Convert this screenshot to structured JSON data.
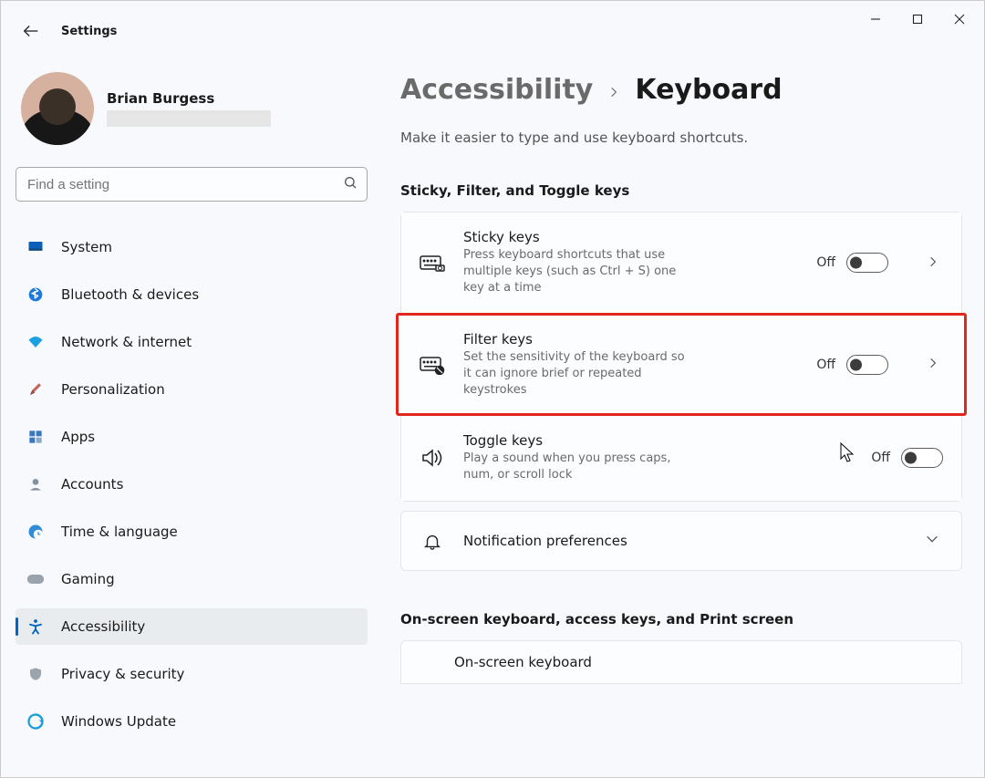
{
  "app_title": "Settings",
  "user": {
    "name": "Brian Burgess"
  },
  "search": {
    "placeholder": "Find a setting"
  },
  "nav": {
    "items": [
      {
        "label": "System"
      },
      {
        "label": "Bluetooth & devices"
      },
      {
        "label": "Network & internet"
      },
      {
        "label": "Personalization"
      },
      {
        "label": "Apps"
      },
      {
        "label": "Accounts"
      },
      {
        "label": "Time & language"
      },
      {
        "label": "Gaming"
      },
      {
        "label": "Accessibility"
      },
      {
        "label": "Privacy & security"
      },
      {
        "label": "Windows Update"
      }
    ]
  },
  "breadcrumb": {
    "parent": "Accessibility",
    "current": "Keyboard"
  },
  "subtitle": "Make it easier to type and use keyboard shortcuts.",
  "sections": {
    "keys_title": "Sticky, Filter, and Toggle keys",
    "osk_title": "On-screen keyboard, access keys, and Print screen"
  },
  "cards": {
    "sticky": {
      "title": "Sticky keys",
      "desc": "Press keyboard shortcuts that use multiple keys (such as Ctrl + S) one key at a time",
      "state": "Off"
    },
    "filter": {
      "title": "Filter keys",
      "desc": "Set the sensitivity of the keyboard so it can ignore brief or repeated keystrokes",
      "state": "Off"
    },
    "toggle": {
      "title": "Toggle keys",
      "desc": "Play a sound when you press caps, num, or scroll lock",
      "state": "Off"
    },
    "notif": {
      "title": "Notification preferences"
    },
    "osk": {
      "title": "On-screen keyboard"
    }
  }
}
